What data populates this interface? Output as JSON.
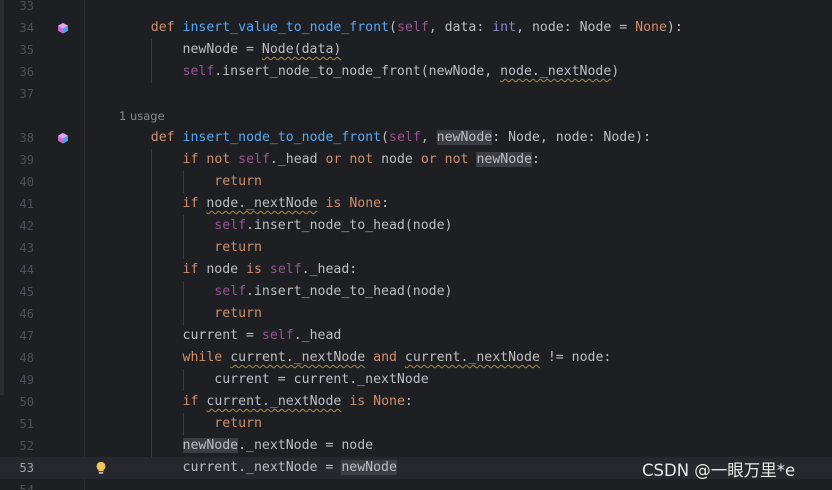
{
  "editor": {
    "language": "python",
    "current_line": 53,
    "lines": [
      {
        "number": 33,
        "tokens": []
      },
      {
        "number": 34,
        "gutter_icon": "implemented-method-icon",
        "tokens": [
          {
            "t": "    "
          },
          {
            "t": "def",
            "c": "kw"
          },
          {
            "t": " "
          },
          {
            "t": "insert_value_to_node_front",
            "c": "fn"
          },
          {
            "t": "("
          },
          {
            "t": "self",
            "c": "sf"
          },
          {
            "t": ", data: "
          },
          {
            "t": "int",
            "c": "bi"
          },
          {
            "t": ", node: Node = "
          },
          {
            "t": "None",
            "c": "kw"
          },
          {
            "t": "):"
          }
        ]
      },
      {
        "number": 35,
        "tokens": [
          {
            "t": "        newNode = "
          },
          {
            "t": "Node(data)",
            "c": "wv"
          }
        ]
      },
      {
        "number": 36,
        "tokens": [
          {
            "t": "        "
          },
          {
            "t": "self",
            "c": "sf"
          },
          {
            "t": ".insert_node_to_node_front(newNode, "
          },
          {
            "t": "node._nextNode",
            "c": "wv"
          },
          {
            "t": ")"
          }
        ]
      },
      {
        "number": 37,
        "tokens": []
      },
      {
        "inlay": "1 usage"
      },
      {
        "number": 38,
        "gutter_icon": "implemented-method-icon",
        "tokens": [
          {
            "t": "    "
          },
          {
            "t": "def",
            "c": "kw"
          },
          {
            "t": " "
          },
          {
            "t": "insert_node_to_node_front",
            "c": "fn"
          },
          {
            "t": "("
          },
          {
            "t": "self",
            "c": "sf"
          },
          {
            "t": ", "
          },
          {
            "t": "newNode",
            "c": "hl"
          },
          {
            "t": ": Node, node: Node):"
          }
        ]
      },
      {
        "number": 39,
        "tokens": [
          {
            "t": "        "
          },
          {
            "t": "if",
            "c": "kw"
          },
          {
            "t": " "
          },
          {
            "t": "not",
            "c": "kw"
          },
          {
            "t": " "
          },
          {
            "t": "self",
            "c": "sf"
          },
          {
            "t": "._head "
          },
          {
            "t": "or",
            "c": "kw"
          },
          {
            "t": " "
          },
          {
            "t": "not",
            "c": "kw"
          },
          {
            "t": " node "
          },
          {
            "t": "or",
            "c": "kw"
          },
          {
            "t": " "
          },
          {
            "t": "not",
            "c": "kw"
          },
          {
            "t": " "
          },
          {
            "t": "newNode",
            "c": "hl"
          },
          {
            "t": ":"
          }
        ]
      },
      {
        "number": 40,
        "tokens": [
          {
            "t": "            "
          },
          {
            "t": "return",
            "c": "kw"
          }
        ]
      },
      {
        "number": 41,
        "tokens": [
          {
            "t": "        "
          },
          {
            "t": "if",
            "c": "kw"
          },
          {
            "t": " "
          },
          {
            "t": "node._nextNode",
            "c": "wv"
          },
          {
            "t": " "
          },
          {
            "t": "is",
            "c": "kw"
          },
          {
            "t": " "
          },
          {
            "t": "None",
            "c": "kw"
          },
          {
            "t": ":"
          }
        ]
      },
      {
        "number": 42,
        "tokens": [
          {
            "t": "            "
          },
          {
            "t": "self",
            "c": "sf"
          },
          {
            "t": ".insert_node_to_head(node)"
          }
        ]
      },
      {
        "number": 43,
        "tokens": [
          {
            "t": "            "
          },
          {
            "t": "return",
            "c": "kw"
          }
        ]
      },
      {
        "number": 44,
        "tokens": [
          {
            "t": "        "
          },
          {
            "t": "if",
            "c": "kw"
          },
          {
            "t": " node "
          },
          {
            "t": "is",
            "c": "kw"
          },
          {
            "t": " "
          },
          {
            "t": "self",
            "c": "sf"
          },
          {
            "t": "._head:"
          }
        ]
      },
      {
        "number": 45,
        "tokens": [
          {
            "t": "            "
          },
          {
            "t": "self",
            "c": "sf"
          },
          {
            "t": ".insert_node_to_head(node)"
          }
        ]
      },
      {
        "number": 46,
        "tokens": [
          {
            "t": "            "
          },
          {
            "t": "return",
            "c": "kw"
          }
        ]
      },
      {
        "number": 47,
        "tokens": [
          {
            "t": "        current = "
          },
          {
            "t": "self",
            "c": "sf"
          },
          {
            "t": "._head"
          }
        ]
      },
      {
        "number": 48,
        "tokens": [
          {
            "t": "        "
          },
          {
            "t": "while",
            "c": "kw"
          },
          {
            "t": " "
          },
          {
            "t": "current._nextNode",
            "c": "wv"
          },
          {
            "t": " "
          },
          {
            "t": "and",
            "c": "kw"
          },
          {
            "t": " "
          },
          {
            "t": "current._nextNode",
            "c": "wv"
          },
          {
            "t": " != node:"
          }
        ]
      },
      {
        "number": 49,
        "tokens": [
          {
            "t": "            current = current._nextNode"
          }
        ]
      },
      {
        "number": 50,
        "tokens": [
          {
            "t": "        "
          },
          {
            "t": "if",
            "c": "kw"
          },
          {
            "t": " "
          },
          {
            "t": "current._nextNode",
            "c": "wv"
          },
          {
            "t": " "
          },
          {
            "t": "is",
            "c": "kw"
          },
          {
            "t": " "
          },
          {
            "t": "None",
            "c": "kw"
          },
          {
            "t": ":"
          }
        ]
      },
      {
        "number": 51,
        "tokens": [
          {
            "t": "            "
          },
          {
            "t": "return",
            "c": "kw"
          }
        ]
      },
      {
        "number": 52,
        "tokens": [
          {
            "t": "        "
          },
          {
            "t": "newNode",
            "c": "hl"
          },
          {
            "t": "._nextNode = node"
          }
        ]
      },
      {
        "number": 53,
        "gutter_icon": "intention-bulb-icon",
        "tokens": [
          {
            "t": "        current._nextNode = "
          },
          {
            "t": "newNode",
            "c": "hl"
          }
        ]
      },
      {
        "number": 54,
        "tokens": []
      }
    ]
  },
  "colors": {
    "background": "#1e1f22",
    "current_line": "#26282e",
    "keyword": "#cf8e6d",
    "function": "#56a8f5",
    "self": "#94558d",
    "builtin": "#8888c6",
    "text": "#bcbec4",
    "line_number": "#4b5059"
  },
  "watermark": "CSDN @一眼万里*e"
}
